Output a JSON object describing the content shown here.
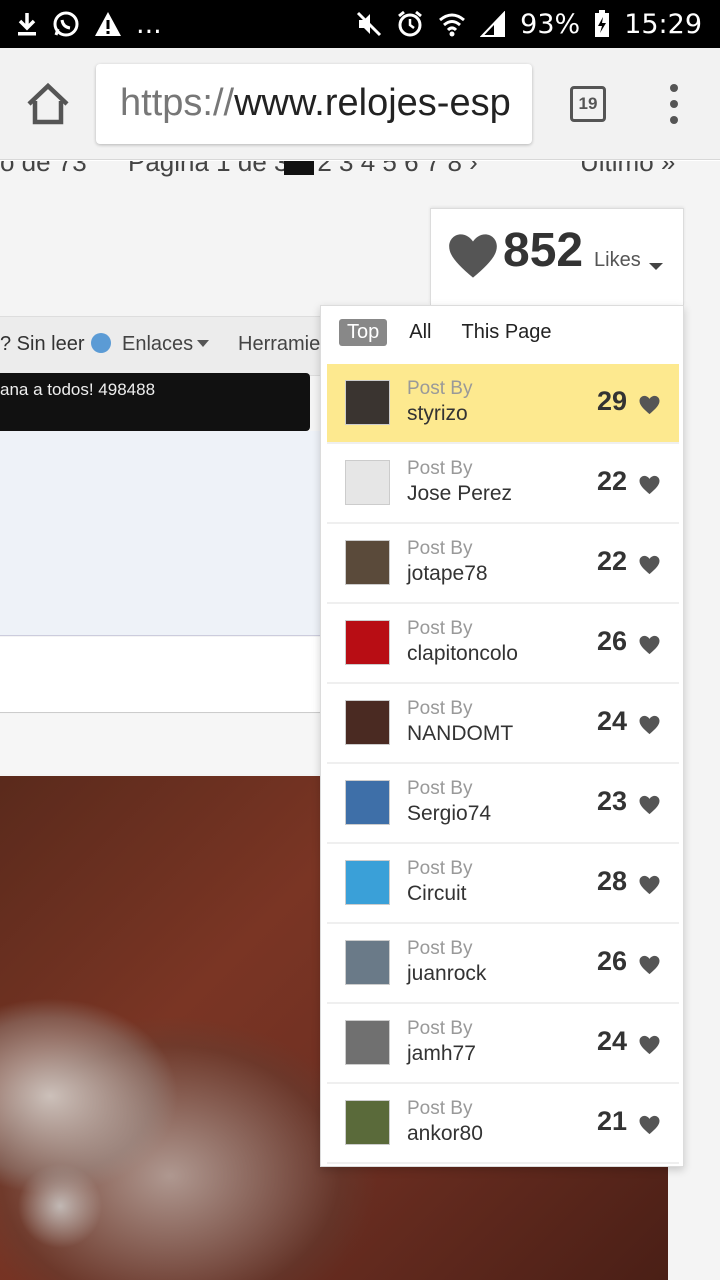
{
  "status_bar": {
    "overflow": "...",
    "battery": "93%",
    "time": "15:29"
  },
  "browser": {
    "url_scheme": "https://",
    "url_rest": "www.relojes-esp",
    "tab_count": "19"
  },
  "page": {
    "pager_left": "o de 73",
    "pager_mid": "Página 1 de 3   1   2   3   4   5   6   7   8   ›",
    "pager_last": "Último »",
    "nav_unread": "? Sin leer",
    "nav_links": "Enlaces",
    "nav_tools": "Herramie",
    "ticker": "ana a todos! 498488"
  },
  "likes": {
    "count": "852",
    "label": "Likes",
    "tabs": [
      "Top",
      "All",
      "This Page"
    ],
    "active_tab": "Top",
    "post_by_label": "Post By",
    "entries": [
      {
        "user": "styrizo",
        "count": "29",
        "avatar_color": "#3a3430",
        "highlight": true
      },
      {
        "user": "Jose Perez",
        "count": "22",
        "avatar_color": "#e6e6e6",
        "highlight": false
      },
      {
        "user": "jotape78",
        "count": "22",
        "avatar_color": "#5a4a3a",
        "highlight": false
      },
      {
        "user": "clapitoncolo",
        "count": "26",
        "avatar_color": "#b80d14",
        "highlight": false
      },
      {
        "user": "NANDOMT",
        "count": "24",
        "avatar_color": "#4a2a22",
        "highlight": false
      },
      {
        "user": "Sergio74",
        "count": "23",
        "avatar_color": "#3e6fa8",
        "highlight": false
      },
      {
        "user": "Circuit",
        "count": "28",
        "avatar_color": "#3aa0d8",
        "highlight": false
      },
      {
        "user": "juanrock",
        "count": "26",
        "avatar_color": "#6a7a88",
        "highlight": false
      },
      {
        "user": "jamh77",
        "count": "24",
        "avatar_color": "#707070",
        "highlight": false
      },
      {
        "user": "ankor80",
        "count": "21",
        "avatar_color": "#5a6a3a",
        "highlight": false
      }
    ]
  },
  "colors": {
    "highlight": "#fde98f",
    "heart": "#555555"
  }
}
